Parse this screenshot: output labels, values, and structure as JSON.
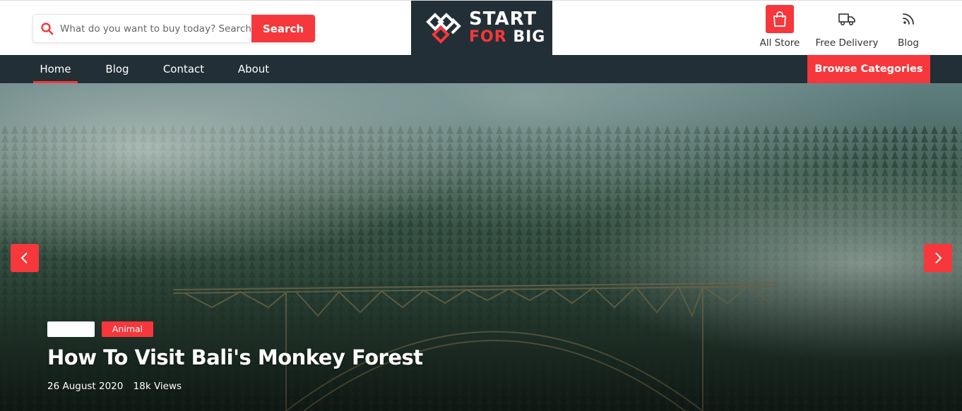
{
  "search": {
    "placeholder": "What do you want to buy today? Search",
    "button_label": "Search"
  },
  "logo": {
    "line1": "START",
    "line2_accent": "FOR",
    "line2_rest": "BIG"
  },
  "utility": {
    "store_label": "All Store",
    "delivery_label": "Free Delivery",
    "blog_label": "Blog"
  },
  "nav": {
    "items": [
      {
        "label": "Home",
        "active": true
      },
      {
        "label": "Blog"
      },
      {
        "label": "Contact"
      },
      {
        "label": "About"
      }
    ],
    "browse_label": "Browse Categories"
  },
  "hero": {
    "tag_blank": "",
    "tag": "Animal",
    "title": "How To Visit Bali's Monkey Forest",
    "date": "26 August 2020",
    "views": "18k Views"
  },
  "colors": {
    "accent": "#f6373b",
    "dark": "#232f36"
  }
}
